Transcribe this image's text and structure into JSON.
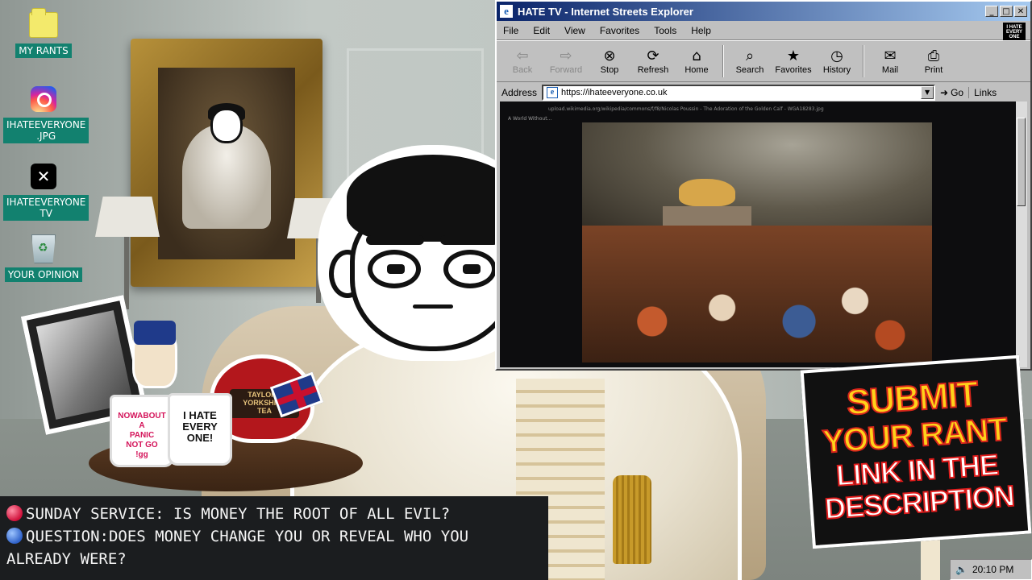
{
  "desktop": {
    "icons": [
      {
        "label": "MY RANTS",
        "icon": "folder-icon"
      },
      {
        "label": "IHATEEVERYONE\n.JPG",
        "icon": "instagram-icon"
      },
      {
        "label": "IHATEEVERYONE\nTV",
        "icon": "x-icon"
      },
      {
        "label": "YOUR OPINION",
        "icon": "recycle-bin-icon"
      }
    ]
  },
  "browser": {
    "title": "HATE TV - Internet Streets Explorer",
    "menu": [
      "File",
      "Edit",
      "View",
      "Favorites",
      "Tools",
      "Help"
    ],
    "brand_badge": "I HATE EVERY ONE",
    "toolbar": [
      {
        "label": "Back",
        "icon": "back-arrow-icon",
        "enabled": false
      },
      {
        "label": "Forward",
        "icon": "forward-arrow-icon",
        "enabled": false
      },
      {
        "label": "Stop",
        "icon": "stop-icon",
        "enabled": true
      },
      {
        "label": "Refresh",
        "icon": "refresh-icon",
        "enabled": true
      },
      {
        "label": "Home",
        "icon": "home-icon",
        "enabled": true
      },
      {
        "label": "Search",
        "icon": "search-icon",
        "enabled": true
      },
      {
        "label": "Favorites",
        "icon": "favorites-icon",
        "enabled": true
      },
      {
        "label": "History",
        "icon": "history-icon",
        "enabled": true
      },
      {
        "label": "Mail",
        "icon": "mail-icon",
        "enabled": true
      },
      {
        "label": "Print",
        "icon": "print-icon",
        "enabled": true
      }
    ],
    "address_label": "Address",
    "address_value": "https://ihateeveryone.co.uk",
    "go_label": "Go",
    "links_label": "Links",
    "content": {
      "inner_url": "upload.wikimedia.org/wikipedia/commons/f/f8/Nicolas Poussin - The Adoration of the Golden Calf - WGA18283.jpg",
      "inner_tab": "A World Without..."
    }
  },
  "props": {
    "teapot_text": "TAYLORS\nYORKSHIRE\nTEA",
    "mug1_text": "NOWABOUT A\nPANIC\nNOT GO\n!gg",
    "mug2_text": "I HATE\nEVERY\nONE!"
  },
  "ticker": {
    "line1": "SUNDAY SERVICE: IS MONEY THE ROOT OF ALL EVIL?",
    "line2": "QUESTION:DOES MONEY CHANGE YOU OR REVEAL WHO YOU ALREADY WERE?"
  },
  "sign": {
    "line1": "SUBMIT",
    "line2": "YOUR RANT",
    "line3": "LINK IN THE",
    "line4": "DESCRIPTION"
  },
  "tray": {
    "time": "20:10 PM"
  },
  "colors": {
    "desktop_label_bg": "#12816f",
    "title_bar": "#0a246a",
    "sign_yellow": "#ffd21a",
    "sign_red": "#e01b1b"
  }
}
